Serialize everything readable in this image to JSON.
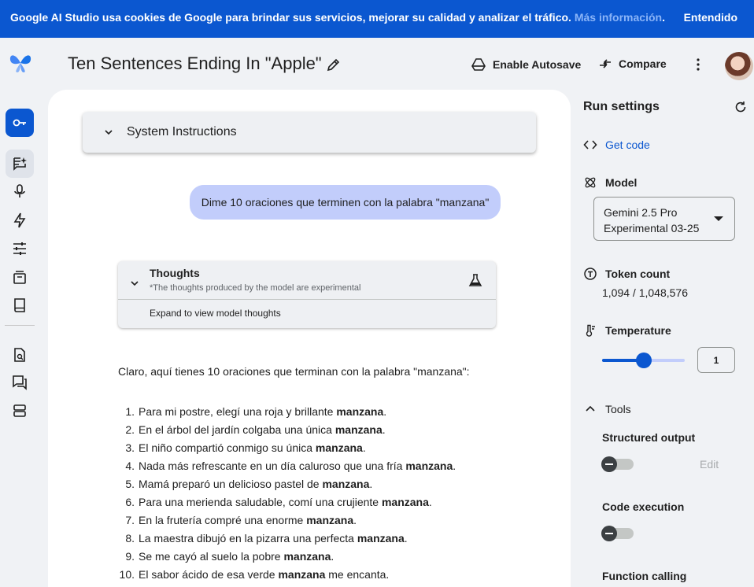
{
  "cookie": {
    "text": "Google AI Studio usa cookies de Google para brindar sus servicios, mejorar su calidad y analizar el tráfico.",
    "link": "Más información",
    "period": ".",
    "accept": "Entendido"
  },
  "header": {
    "title": "Ten Sentences Ending In \"Apple\"",
    "autosave": "Enable Autosave",
    "compare": "Compare"
  },
  "chat": {
    "system_instructions": "System Instructions",
    "user_message": "Dime 10 oraciones que terminen con la palabra \"manzana\"",
    "thoughts": {
      "title": "Thoughts",
      "subtitle": "*The thoughts produced by the model are experimental",
      "expand": "Expand to view model thoughts"
    },
    "answer_intro": "Claro, aquí tienes 10 oraciones que terminan con la palabra \"manzana\":",
    "items": [
      {
        "n": "1.",
        "pre": "Para mi postre, elegí una roja y brillante ",
        "bold": "manzana",
        "post": "."
      },
      {
        "n": "2.",
        "pre": "En el árbol del jardín colgaba una única ",
        "bold": "manzana",
        "post": "."
      },
      {
        "n": "3.",
        "pre": "El niño compartió conmigo su única ",
        "bold": "manzana",
        "post": "."
      },
      {
        "n": "4.",
        "pre": "Nada más refrescante en un día caluroso que una fría ",
        "bold": "manzana",
        "post": "."
      },
      {
        "n": "5.",
        "pre": "Mamá preparó un delicioso pastel de ",
        "bold": "manzana",
        "post": "."
      },
      {
        "n": "6.",
        "pre": "Para una merienda saludable, comí una crujiente ",
        "bold": "manzana",
        "post": "."
      },
      {
        "n": "7.",
        "pre": "En la frutería compré una enorme ",
        "bold": "manzana",
        "post": "."
      },
      {
        "n": "8.",
        "pre": "La maestra dibujó en la pizarra una perfecta ",
        "bold": "manzana",
        "post": "."
      },
      {
        "n": "9.",
        "pre": "Se me cayó al suelo la pobre ",
        "bold": "manzana",
        "post": "."
      },
      {
        "n": "10.",
        "pre": "El sabor ácido de esa verde ",
        "bold": "manzana",
        "post": " me encanta."
      }
    ]
  },
  "settings": {
    "title": "Run settings",
    "get_code": "Get code",
    "model_label": "Model",
    "model_line1": "Gemini 2.5 Pro",
    "model_line2": "Experimental 03-25",
    "token_label": "Token count",
    "token_value": "1,094 / 1,048,576",
    "temperature_label": "Temperature",
    "temperature_value": "1",
    "temperature_fraction": 0.5,
    "tools_label": "Tools",
    "structured_output": "Structured output",
    "edit": "Edit",
    "code_execution": "Code execution",
    "function_calling": "Function calling"
  },
  "colors": {
    "accent": "#0b57d0",
    "user_bubble": "#c2cdfb",
    "background": "#f0f2f5"
  }
}
